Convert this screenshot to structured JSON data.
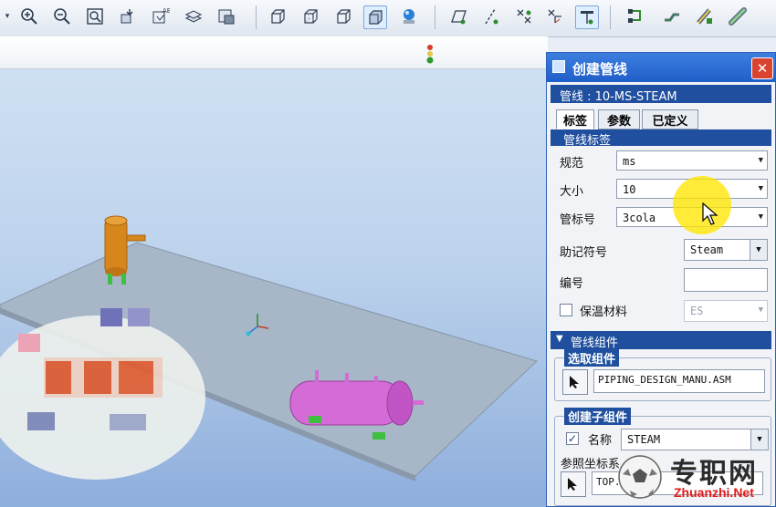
{
  "dialog": {
    "title": "创建管线",
    "close_glyph": "✕",
    "pipeline_line": "管线 : 10-MS-STEAM",
    "tabs": [
      {
        "label": "标签"
      },
      {
        "label": "参数"
      },
      {
        "label": "已定义"
      }
    ],
    "label_section": "管线标签",
    "fields": {
      "spec": {
        "label": "规范",
        "value": "ms"
      },
      "size": {
        "label": "大小",
        "value": "10"
      },
      "tag": {
        "label": "管标号",
        "value": "3cola"
      },
      "mnemonic": {
        "label": "助记符号",
        "value": "Steam"
      },
      "number": {
        "label": "编号",
        "value": ""
      },
      "insulation": {
        "label": "保温材料",
        "value": "ES",
        "checked": false
      }
    },
    "assembly_section": "管线组件",
    "select_group": {
      "title": "选取组件",
      "value": "PIPING_DESIGN_MANU.ASM"
    },
    "create_group": {
      "title": "创建子组件",
      "name_label": "名称",
      "name_value": "STEAM",
      "name_checked": true,
      "ref_label": "参照坐标系",
      "ref_value": "TOP.."
    }
  },
  "watermark": {
    "text": "专职网",
    "url": "Zhuanzhi.Net"
  },
  "toolbar": {
    "icons": [
      "dropdown-arrow-icon",
      "zoom-in-icon",
      "zoom-out-icon",
      "zoom-fit-icon",
      "orient-icon",
      "saved-views-icon",
      "layers-icon",
      "render-icon",
      "display-wireframe-icon",
      "display-hidden-icon",
      "display-no-hidden-icon",
      "display-shaded-icon",
      "appearance-icon",
      "datum-plane-icon",
      "datum-axis-icon",
      "datum-point-icon",
      "datum-csys-icon",
      "pipe-route-icon",
      "pipe-network-icon",
      "pipe-fitting-icon",
      "pipe-insulation-icon",
      "pipe-extend-icon"
    ]
  },
  "colors": {
    "title_bar": "#1f5fc8",
    "section_band": "#1f4f9e",
    "highlight": "#ffe600"
  }
}
